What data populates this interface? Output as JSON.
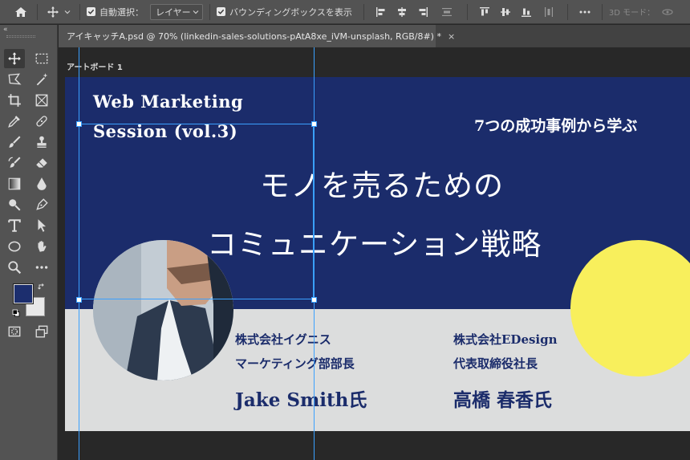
{
  "options_bar": {
    "auto_select_label": "自動選択：",
    "auto_select_target": "レイヤー",
    "show_transform_label": "バウンディングボックスを表示",
    "mode_3d_label": "3D モード："
  },
  "document": {
    "tab_title": "アイキャッチA.psd @ 70% (linkedin-sales-solutions-pAtA8xe_iVM-unsplash, RGB/8#) *",
    "close_glyph": "×",
    "artboard_label": "アートボード 1"
  },
  "design": {
    "event_line1": "Web Marketing",
    "event_line2": "Session (vol.3)",
    "subtitle": "7つの成功事例から学ぶ",
    "headline_line1": "モノを売るための",
    "headline_line2": "コミュニケーション戦略",
    "speaker1": {
      "company": "株式会社イグニス",
      "title": "マーケティング部部長",
      "name": "Jake Smith氏"
    },
    "speaker2": {
      "company": "株式会社EDesign",
      "title": "代表取締役社長",
      "name": "高橋 春香氏"
    }
  },
  "colors": {
    "navy": "#1b2c6b",
    "yellow": "#f8ef5c",
    "light_grey": "#dcdddd",
    "guide": "#3aa0ff",
    "foreground_color": "#1c2e6e",
    "background_color": "#e8e8e8"
  }
}
